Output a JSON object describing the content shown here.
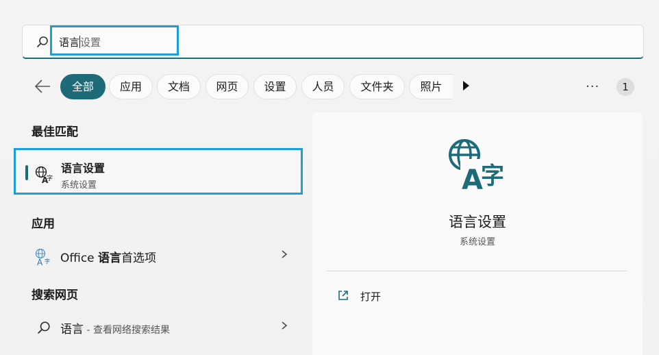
{
  "search": {
    "typed": "语言",
    "suggestion": "设置"
  },
  "filters": [
    "全部",
    "应用",
    "文档",
    "网页",
    "设置",
    "人员",
    "文件夹",
    "照片"
  ],
  "badge_count": "1",
  "more_dots": "···",
  "best_match": {
    "heading": "最佳匹配",
    "title": "语言设置",
    "subtitle": "系统设置"
  },
  "apps": {
    "heading": "应用",
    "item_prefix": "Office ",
    "item_bold": "语言",
    "item_suffix": "首选项"
  },
  "web": {
    "heading": "搜索网页",
    "item_label": "语言",
    "item_sub": " - 查看网络搜索结果"
  },
  "detail": {
    "title": "语言设置",
    "subtitle": "系统设置",
    "action_open": "打开"
  },
  "colors": {
    "accent": "#1d6b78",
    "highlight": "#1a9fd8"
  },
  "icons": {
    "search": "search-icon",
    "back": "back-arrow-icon",
    "language": "language-icon",
    "open": "open-external-icon",
    "chevron": "chevron-right-icon",
    "play": "more-filters-icon"
  }
}
